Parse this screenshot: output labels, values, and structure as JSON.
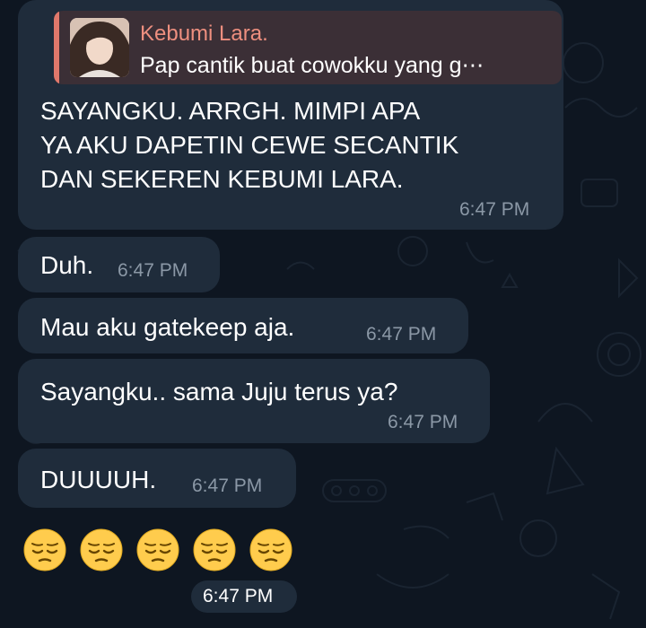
{
  "reply": {
    "name": "Kebumi Lara.",
    "snippet": "Pap cantik buat cowokku yang g⋯",
    "accent": "#e0786b"
  },
  "messages": [
    {
      "lines": [
        "SAYANGKU. ARRGH. MIMPI APA",
        "YA AKU DAPETIN CEWE SECANTIK",
        "DAN SEKEREN KEBUMI LARA."
      ],
      "time": "6:47 PM"
    },
    {
      "text": "Duh.",
      "time": "6:47 PM"
    },
    {
      "text": "Mau aku gatekeep aja.",
      "time": "6:47 PM"
    },
    {
      "text": "Sayangku.. sama Juju terus ya?",
      "time": "6:47 PM"
    },
    {
      "text": "DUUUUH.",
      "time": "6:47 PM"
    }
  ],
  "emoji_message": {
    "emojis": [
      "pensive-face",
      "pensive-face",
      "pensive-face",
      "pensive-face",
      "pensive-face"
    ],
    "time": "6:47 PM"
  },
  "colors": {
    "background": "#0e1621",
    "bubble": "#1f2c3b",
    "timestamp": "#8b98a6",
    "reply_background": "#3b2f36",
    "reply_name": "#ee8f7f"
  }
}
